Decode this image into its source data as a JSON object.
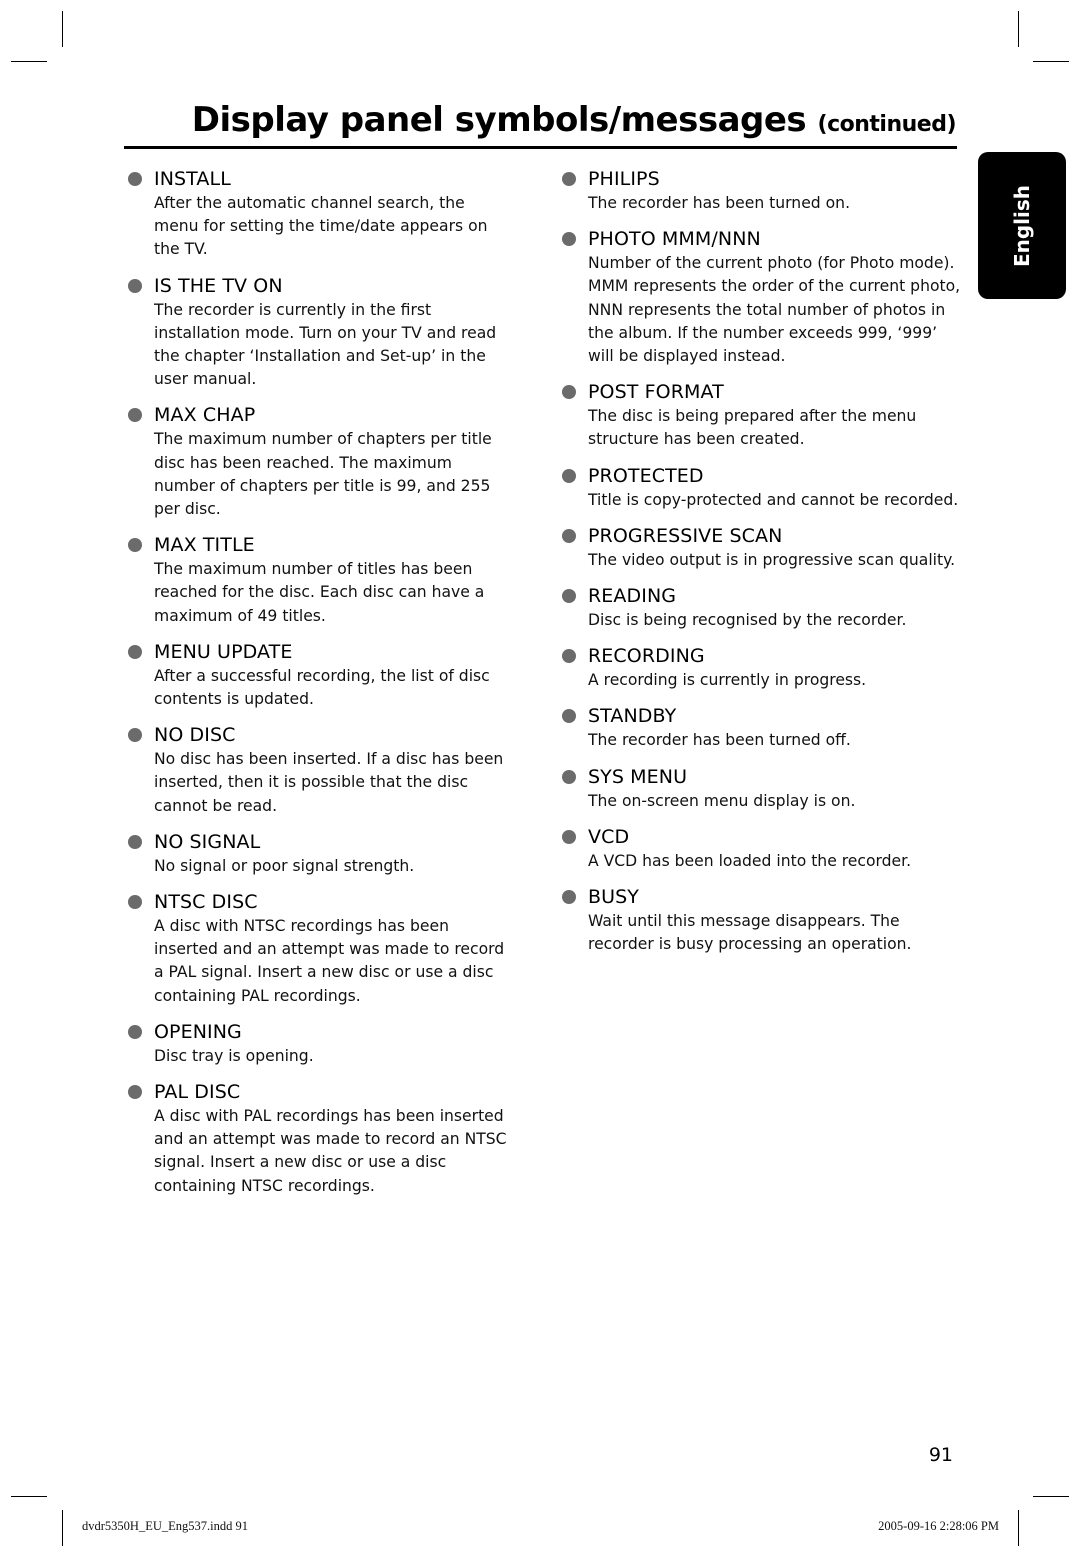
{
  "header": {
    "title": "Display panel symbols/messages",
    "title_suffix": "(continued)"
  },
  "language_tab": "English",
  "left_column": [
    {
      "title": "INSTALL",
      "description": "After the automatic channel search, the menu for setting the time/date appears on the TV."
    },
    {
      "title": "IS THE TV ON",
      "description": "The recorder is currently in the first installation mode. Turn on your TV and read the chapter ‘Installation and Set-up’ in the user manual."
    },
    {
      "title": "MAX CHAP",
      "description": "The maximum number of chapters per title disc has been reached. The maximum number of chapters per title is 99, and 255 per disc."
    },
    {
      "title": "MAX TITLE",
      "description": "The maximum number of titles has been reached for the disc. Each disc can have a maximum of 49 titles."
    },
    {
      "title": "MENU UPDATE",
      "description": "After a successful recording, the list of disc contents is updated."
    },
    {
      "title": "NO DISC",
      "description": "No disc has been inserted. If a disc has been inserted, then it is possible that the disc cannot be read."
    },
    {
      "title": "NO SIGNAL",
      "description": "No signal or poor signal strength."
    },
    {
      "title": "NTSC DISC",
      "description": "A disc with NTSC recordings has been inserted and an attempt was made to record a PAL signal. Insert a new disc or use a disc containing PAL recordings."
    },
    {
      "title": "OPENING",
      "description": "Disc tray is opening."
    },
    {
      "title": "PAL DISC",
      "description": "A disc with PAL recordings has been inserted and an attempt was made to record an NTSC signal. Insert a new disc or use a disc containing NTSC recordings."
    }
  ],
  "right_column": [
    {
      "title": "PHILIPS",
      "description": "The recorder has been turned on."
    },
    {
      "title": "PHOTO MMM/NNN",
      "description": "Number of the current photo (for Photo mode). MMM represents the order of the current photo, NNN represents the total number of photos in the album. If the number exceeds 999, ‘999’ will be displayed instead."
    },
    {
      "title": "POST FORMAT",
      "description": "The disc is being prepared after the menu structure has been created."
    },
    {
      "title": "PROTECTED",
      "description": "Title is copy-protected and cannot be recorded."
    },
    {
      "title": "PROGRESSIVE SCAN",
      "description": "The video output is in progressive scan quality."
    },
    {
      "title": "READING",
      "description": "Disc is being recognised by the recorder."
    },
    {
      "title": "RECORDING",
      "description": "A recording is currently in progress."
    },
    {
      "title": "STANDBY",
      "description": "The recorder has been turned off."
    },
    {
      "title": "SYS MENU",
      "description": "The on-screen menu display is on."
    },
    {
      "title": "VCD",
      "description": "A VCD has been loaded into the recorder."
    },
    {
      "title": "BUSY",
      "description": "Wait until this message disappears. The recorder is busy processing an operation."
    }
  ],
  "page_number": "91",
  "footer": {
    "file_info": "dvdr5350H_EU_Eng537.indd   91",
    "timestamp": "2005-09-16   2:28:06 PM"
  }
}
